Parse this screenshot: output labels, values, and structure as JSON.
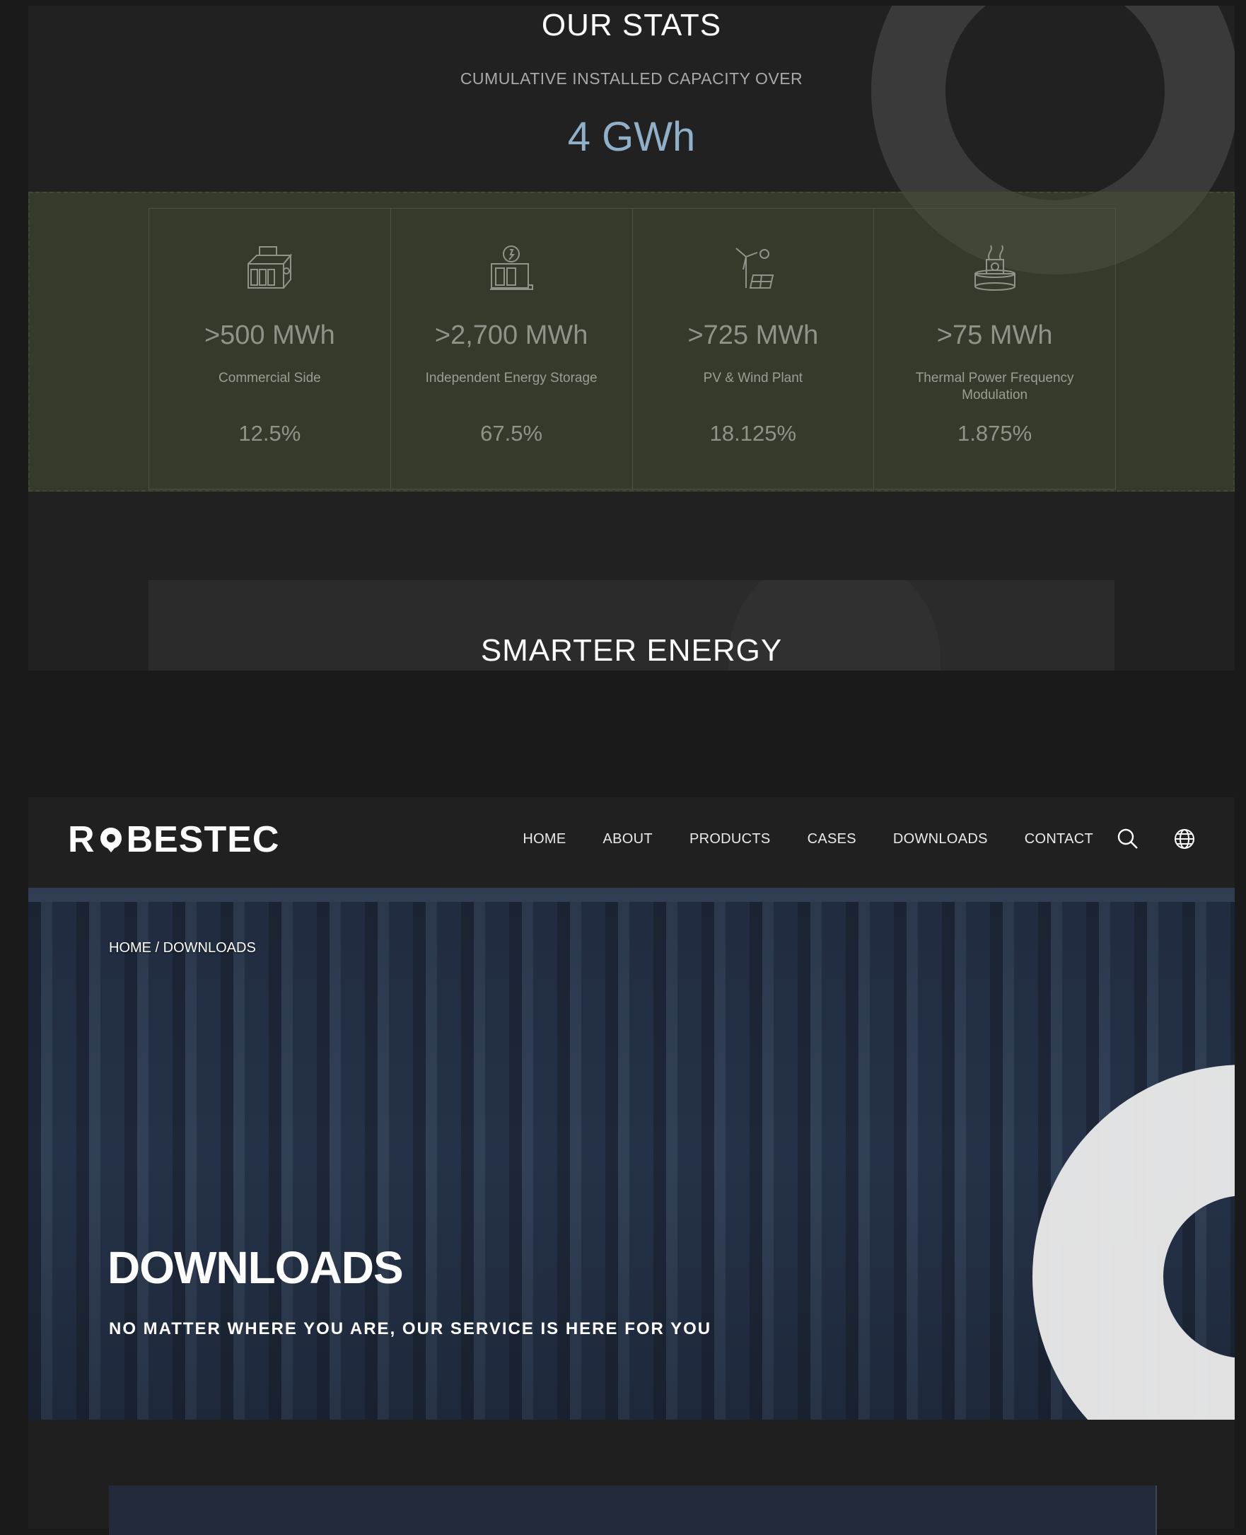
{
  "stats": {
    "title": "OUR STATS",
    "subtitle": "CUMULATIVE INSTALLED CAPACITY OVER",
    "total": "4 GWh",
    "items": [
      {
        "icon": "battery-cabinet-icon",
        "value": ">500 MWh",
        "label": "Commercial Side",
        "percent": "12.5%"
      },
      {
        "icon": "energy-storage-icon",
        "value": ">2,700 MWh",
        "label": "Independent Energy Storage",
        "percent": "67.5%"
      },
      {
        "icon": "wind-solar-icon",
        "value": ">725 MWh",
        "label": "PV & Wind Plant",
        "percent": "18.125%"
      },
      {
        "icon": "thermal-power-icon",
        "value": ">75 MWh",
        "label": "Thermal Power Frequency Modulation",
        "percent": "1.875%"
      }
    ],
    "next_title": "SMARTER ENERGY"
  },
  "header": {
    "logo": {
      "left": "R",
      "right": "BESTEC"
    },
    "nav": [
      "HOME",
      "ABOUT",
      "PRODUCTS",
      "CASES",
      "DOWNLOADS",
      "CONTACT"
    ],
    "icons": [
      "search-icon",
      "globe-icon"
    ]
  },
  "hero": {
    "breadcrumb": "HOME / DOWNLOADS",
    "title": "DOWNLOADS",
    "subtitle": "NO MATTER WHERE YOU ARE, OUR SERVICE IS HERE FOR YOU"
  },
  "colors": {
    "page_bg": "#1a1a1a",
    "panel_bg": "#212121",
    "accent_value": "#8fb0c8",
    "band_green": "#465234",
    "hero_blue": "#27344a"
  }
}
